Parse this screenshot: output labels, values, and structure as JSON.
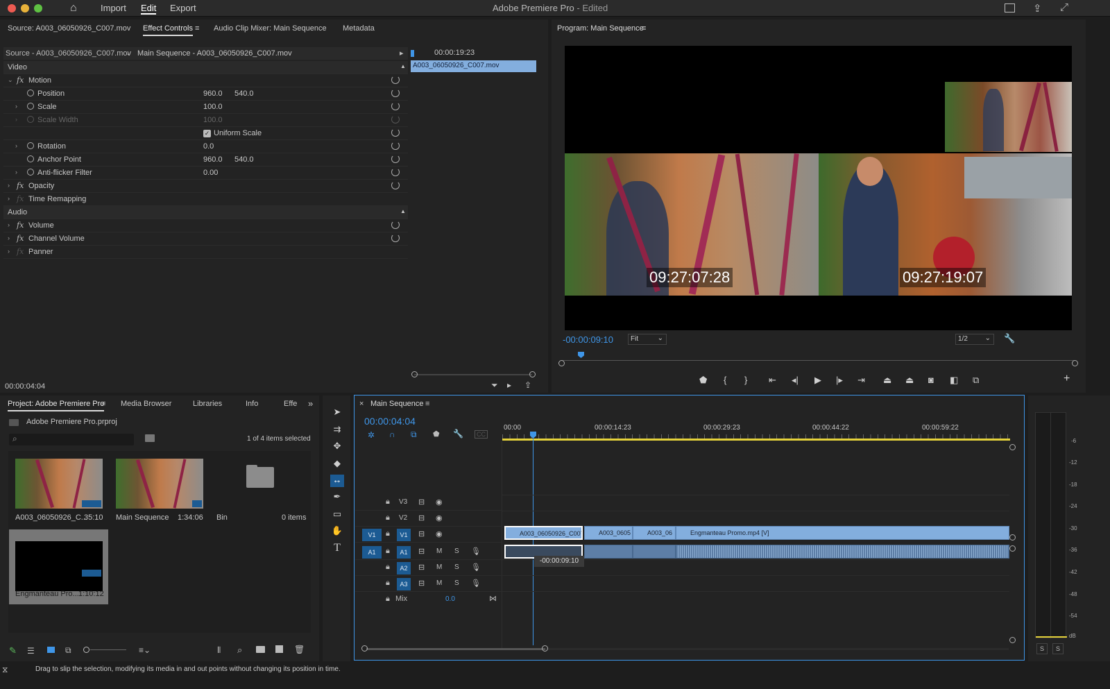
{
  "app": {
    "title": "Adobe Premiere Pro",
    "status": "- Edited",
    "menu": [
      "Import",
      "Edit",
      "Export"
    ],
    "active_menu": "Edit"
  },
  "source_panel": {
    "tabs": [
      "Source: A003_06050926_C007.mov",
      "Effect Controls",
      "Audio Clip Mixer: Main Sequence",
      "Metadata"
    ],
    "source_label": "Source - A003_06050926_C007.mov",
    "sequence_label": "Main Sequence - A003_06050926_C007.mov",
    "mini_timecode": "00:00:19:23",
    "mini_clip": "A003_06050926_C007.mov",
    "sections": {
      "video": "Video",
      "audio": "Audio"
    },
    "effects": {
      "motion": "Motion",
      "position": {
        "label": "Position",
        "x": "960.0",
        "y": "540.0"
      },
      "scale": {
        "label": "Scale",
        "value": "100.0"
      },
      "scale_width": {
        "label": "Scale Width",
        "value": "100.0"
      },
      "uniform_scale": "Uniform Scale",
      "rotation": {
        "label": "Rotation",
        "value": "0.0"
      },
      "anchor_point": {
        "label": "Anchor Point",
        "x": "960.0",
        "y": "540.0"
      },
      "anti_flicker": {
        "label": "Anti-flicker Filter",
        "value": "0.00"
      },
      "opacity": "Opacity",
      "time_remapping": "Time Remapping",
      "volume": "Volume",
      "channel_volume": "Channel Volume",
      "panner": "Panner"
    },
    "current_time": "00:00:04:04"
  },
  "program": {
    "tab": "Program: Main Sequence",
    "timecode_left": "09:27:07:28",
    "timecode_right": "09:27:19:07",
    "playhead_offset": "-00:00:09:10",
    "fit": "Fit",
    "resolution": "1/2"
  },
  "project": {
    "tabs": [
      "Project: Adobe Premiere Pro",
      "Media Browser",
      "Libraries",
      "Info",
      "Effe"
    ],
    "file": "Adobe Premiere Pro.prproj",
    "selection_count": "1 of 4 items selected",
    "items": [
      {
        "name": "A003_06050926_C...",
        "duration": "35:10"
      },
      {
        "name": "Main Sequence",
        "duration": "1:34:06"
      },
      {
        "name": "Bin",
        "duration": "0 items"
      },
      {
        "name": "Engmanteau Pro...",
        "duration": "1:10:12"
      }
    ]
  },
  "timeline": {
    "tab": "Main Sequence",
    "timecode": "00:00:04:04",
    "ruler": [
      "00:00",
      "00:00:14:23",
      "00:00:29:23",
      "00:00:44:22",
      "00:00:59:22"
    ],
    "tracks": {
      "video": [
        "V3",
        "V2",
        "V1"
      ],
      "audio": [
        "A1",
        "A2",
        "A3"
      ],
      "source_v": "V1",
      "source_a": "A1",
      "mix_label": "Mix",
      "mix_value": "0.0",
      "m": "M",
      "s": "S"
    },
    "clips": [
      "A003_06050926_C007",
      "A003_0605",
      "A003_06",
      "Engmanteau Promo.mp4 [V]"
    ],
    "slip_tooltip": "-00:00:09:10"
  },
  "meters": {
    "labels": [
      "-6",
      "-12",
      "-18",
      "-24",
      "-30",
      "-36",
      "-42",
      "-48",
      "-54",
      "dB"
    ],
    "solo": [
      "S",
      "S"
    ]
  },
  "statusbar": {
    "text": "Drag to slip the selection, modifying its media in and out points without changing its position in time."
  },
  "colors": {
    "accent": "#3f96e8",
    "clip_video": "#83aede",
    "clip_audio": "#5d7ea6",
    "yellow_bar": "#e5d23a"
  }
}
